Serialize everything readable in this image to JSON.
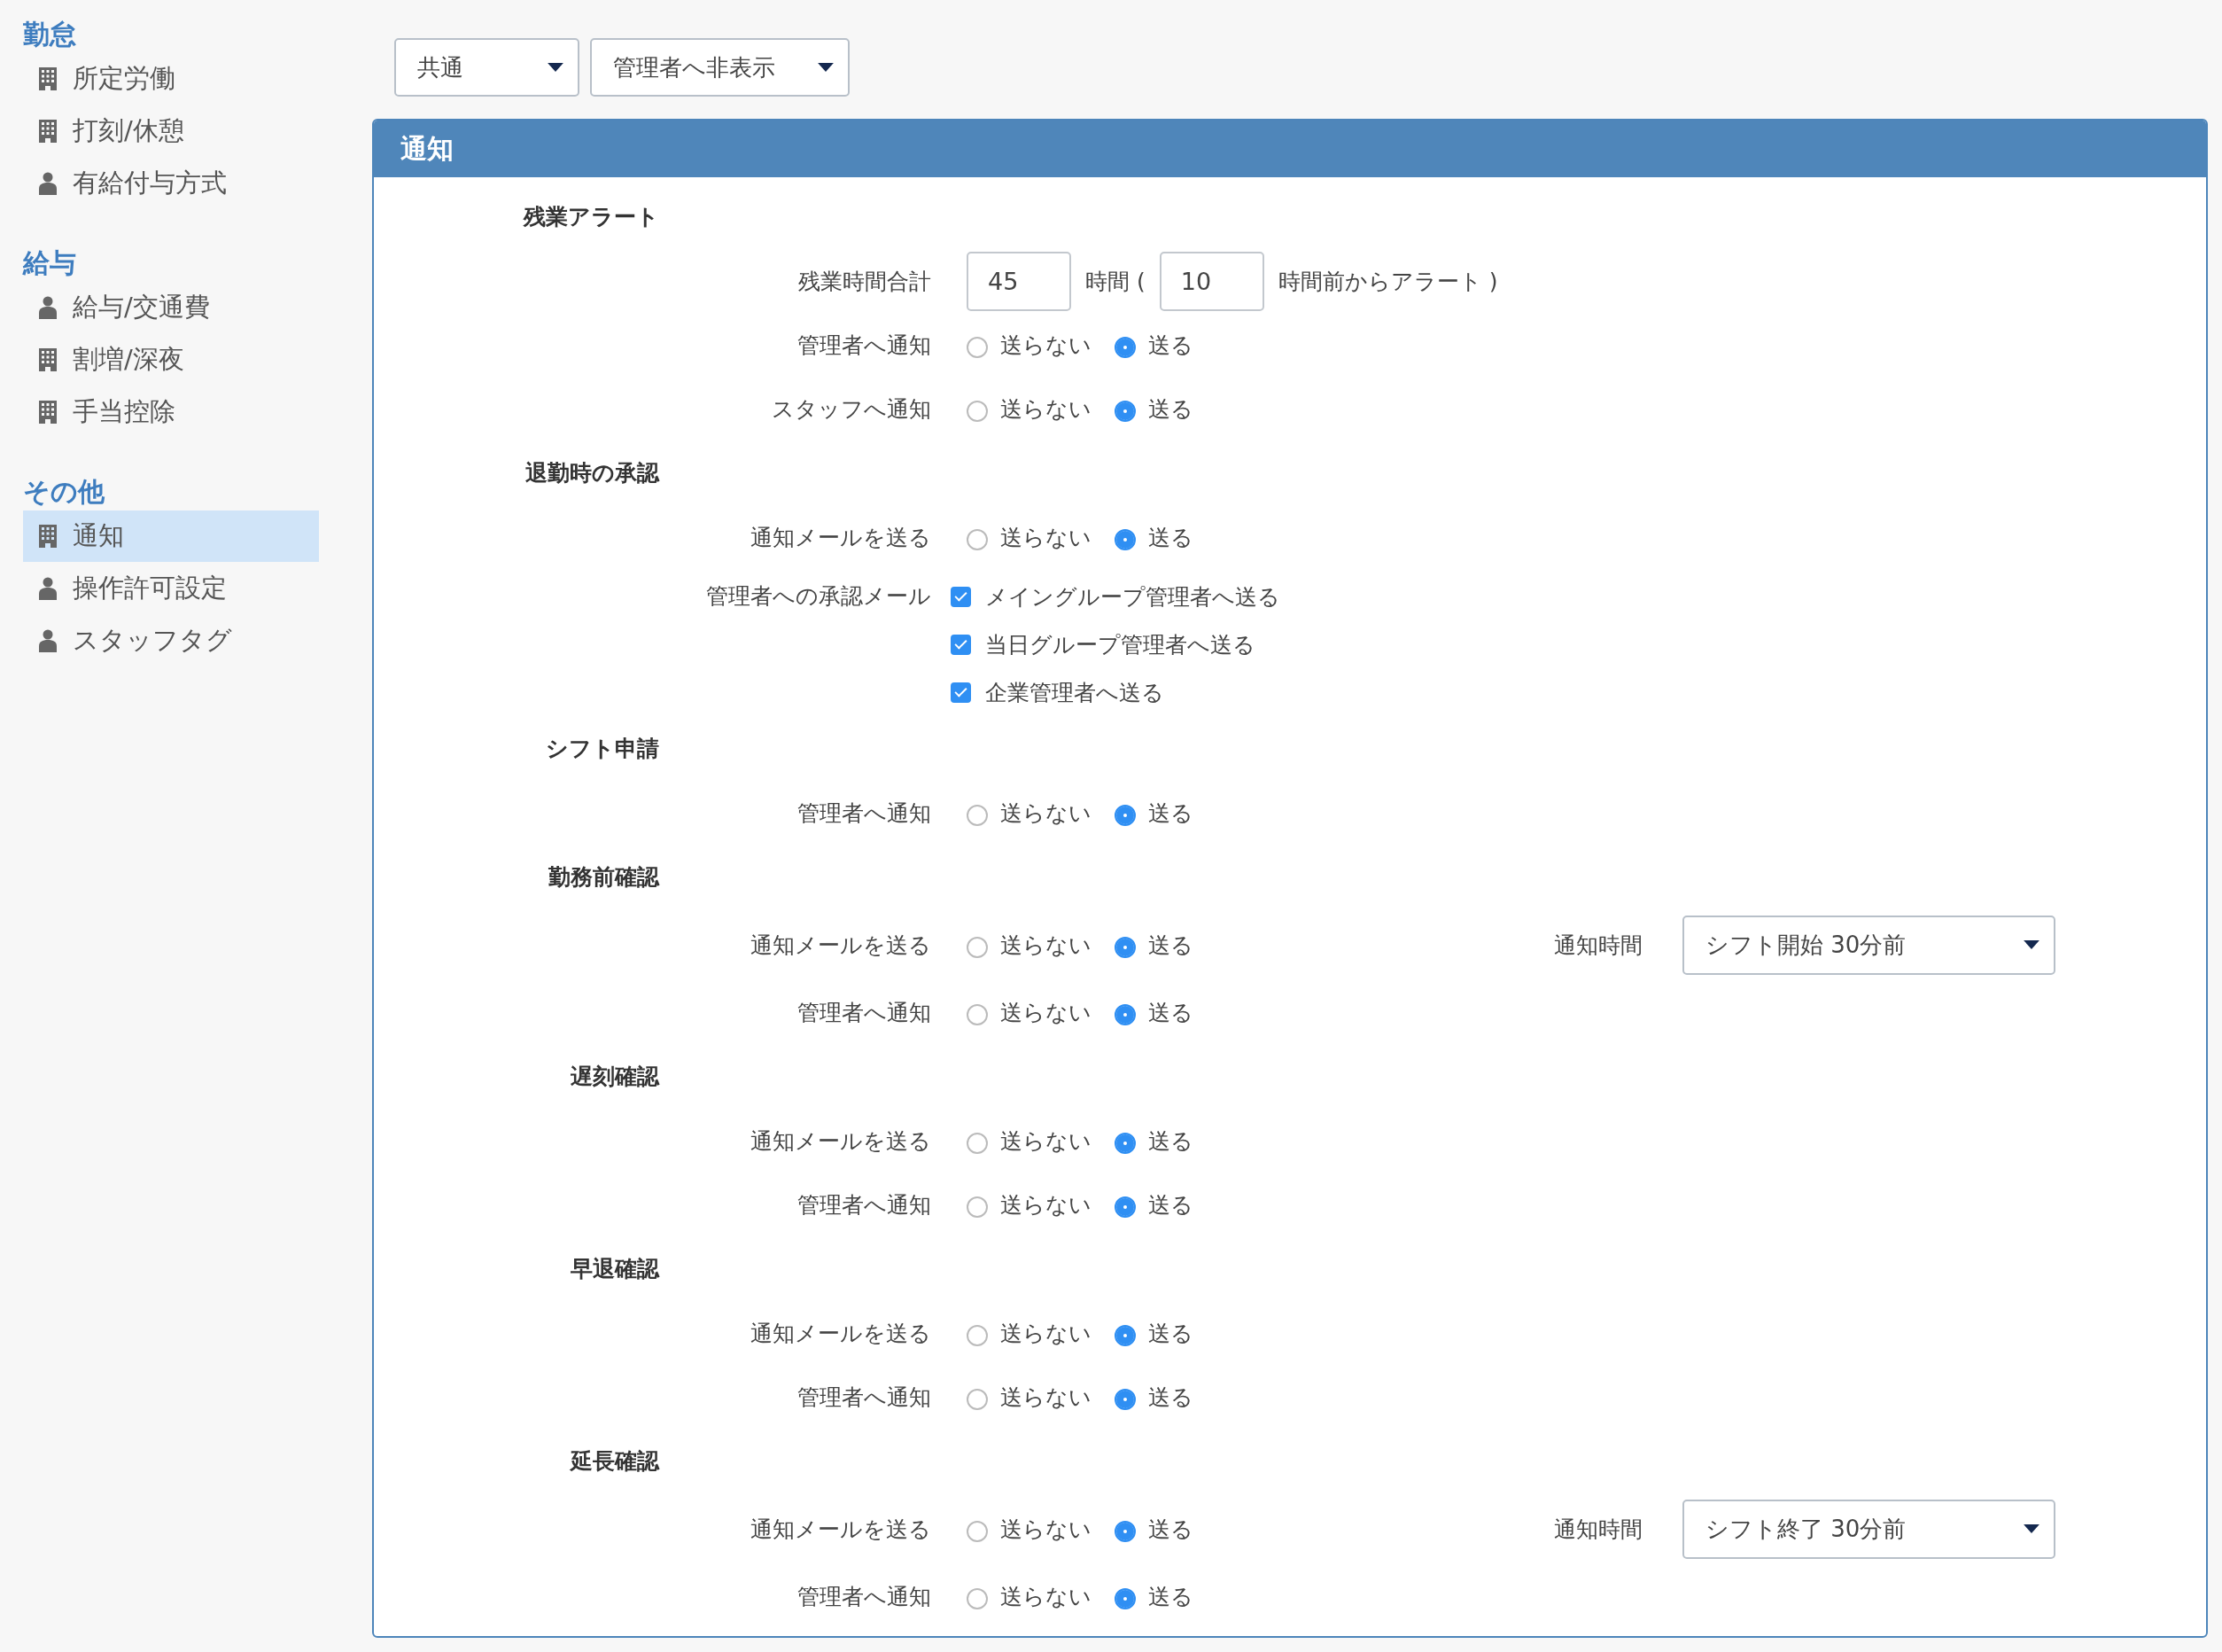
{
  "sidebar": {
    "groups": [
      {
        "title": "勤怠",
        "items": [
          {
            "label": "所定労働",
            "kind": "company",
            "selected": false
          },
          {
            "label": "打刻/休憩",
            "kind": "company",
            "selected": false
          },
          {
            "label": "有給付与方式",
            "kind": "staff",
            "selected": false
          }
        ]
      },
      {
        "title": "給与",
        "items": [
          {
            "label": "給与/交通費",
            "kind": "staff",
            "selected": false
          },
          {
            "label": "割増/深夜",
            "kind": "company",
            "selected": false
          },
          {
            "label": "手当控除",
            "kind": "company",
            "selected": false
          }
        ]
      },
      {
        "title": "その他",
        "items": [
          {
            "label": "通知",
            "kind": "company",
            "selected": true
          },
          {
            "label": "操作許可設定",
            "kind": "staff",
            "selected": false
          },
          {
            "label": "スタッフタグ",
            "kind": "staff",
            "selected": false
          }
        ]
      }
    ]
  },
  "filters": [
    {
      "value": "共通"
    },
    {
      "value": "管理者へ非表示"
    }
  ],
  "panel": {
    "title": "通知",
    "sections": [
      {
        "title": "残業アラート",
        "rows": [
          {
            "kind": "hours",
            "label": "残業時間合計",
            "total": "45",
            "unit": "時間 (",
            "lead": "10",
            "suffix": "時間前からアラート )"
          },
          {
            "kind": "radio",
            "label": "管理者へ通知",
            "options": [
              {
                "label": "送らない",
                "selected": false
              },
              {
                "label": "送る",
                "selected": true
              }
            ]
          },
          {
            "kind": "radio",
            "label": "スタッフへ通知",
            "options": [
              {
                "label": "送らない",
                "selected": false
              },
              {
                "label": "送る",
                "selected": true
              }
            ]
          }
        ]
      },
      {
        "title": "退勤時の承認",
        "rows": [
          {
            "kind": "radio",
            "label": "通知メールを送る",
            "options": [
              {
                "label": "送らない",
                "selected": false
              },
              {
                "label": "送る",
                "selected": true
              }
            ]
          },
          {
            "kind": "checkboxes",
            "label": "管理者への承認メール",
            "options": [
              {
                "label": "メイングループ管理者へ送る",
                "checked": true
              },
              {
                "label": "当日グループ管理者へ送る",
                "checked": true
              },
              {
                "label": "企業管理者へ送る",
                "checked": true
              }
            ]
          }
        ]
      },
      {
        "title": "シフト申請",
        "rows": [
          {
            "kind": "radio",
            "label": "管理者へ通知",
            "options": [
              {
                "label": "送らない",
                "selected": false
              },
              {
                "label": "送る",
                "selected": true
              }
            ]
          }
        ]
      },
      {
        "title": "勤務前確認",
        "rows": [
          {
            "kind": "radio",
            "label": "通知メールを送る",
            "options": [
              {
                "label": "送らない",
                "selected": false
              },
              {
                "label": "送る",
                "selected": true
              }
            ],
            "timing": {
              "label": "通知時間",
              "value": "シフト開始 30分前"
            }
          },
          {
            "kind": "radio",
            "label": "管理者へ通知",
            "options": [
              {
                "label": "送らない",
                "selected": false
              },
              {
                "label": "送る",
                "selected": true
              }
            ]
          }
        ]
      },
      {
        "title": "遅刻確認",
        "rows": [
          {
            "kind": "radio",
            "label": "通知メールを送る",
            "options": [
              {
                "label": "送らない",
                "selected": false
              },
              {
                "label": "送る",
                "selected": true
              }
            ]
          },
          {
            "kind": "radio",
            "label": "管理者へ通知",
            "options": [
              {
                "label": "送らない",
                "selected": false
              },
              {
                "label": "送る",
                "selected": true
              }
            ]
          }
        ]
      },
      {
        "title": "早退確認",
        "rows": [
          {
            "kind": "radio",
            "label": "通知メールを送る",
            "options": [
              {
                "label": "送らない",
                "selected": false
              },
              {
                "label": "送る",
                "selected": true
              }
            ]
          },
          {
            "kind": "radio",
            "label": "管理者へ通知",
            "options": [
              {
                "label": "送らない",
                "selected": false
              },
              {
                "label": "送る",
                "selected": true
              }
            ]
          }
        ]
      },
      {
        "title": "延長確認",
        "rows": [
          {
            "kind": "radio",
            "label": "通知メールを送る",
            "options": [
              {
                "label": "送らない",
                "selected": false
              },
              {
                "label": "送る",
                "selected": true
              }
            ],
            "timing": {
              "label": "通知時間",
              "value": "シフト終了 30分前"
            }
          },
          {
            "kind": "radio",
            "label": "管理者へ通知",
            "options": [
              {
                "label": "送らない",
                "selected": false
              },
              {
                "label": "送る",
                "selected": true
              }
            ]
          }
        ]
      }
    ]
  }
}
